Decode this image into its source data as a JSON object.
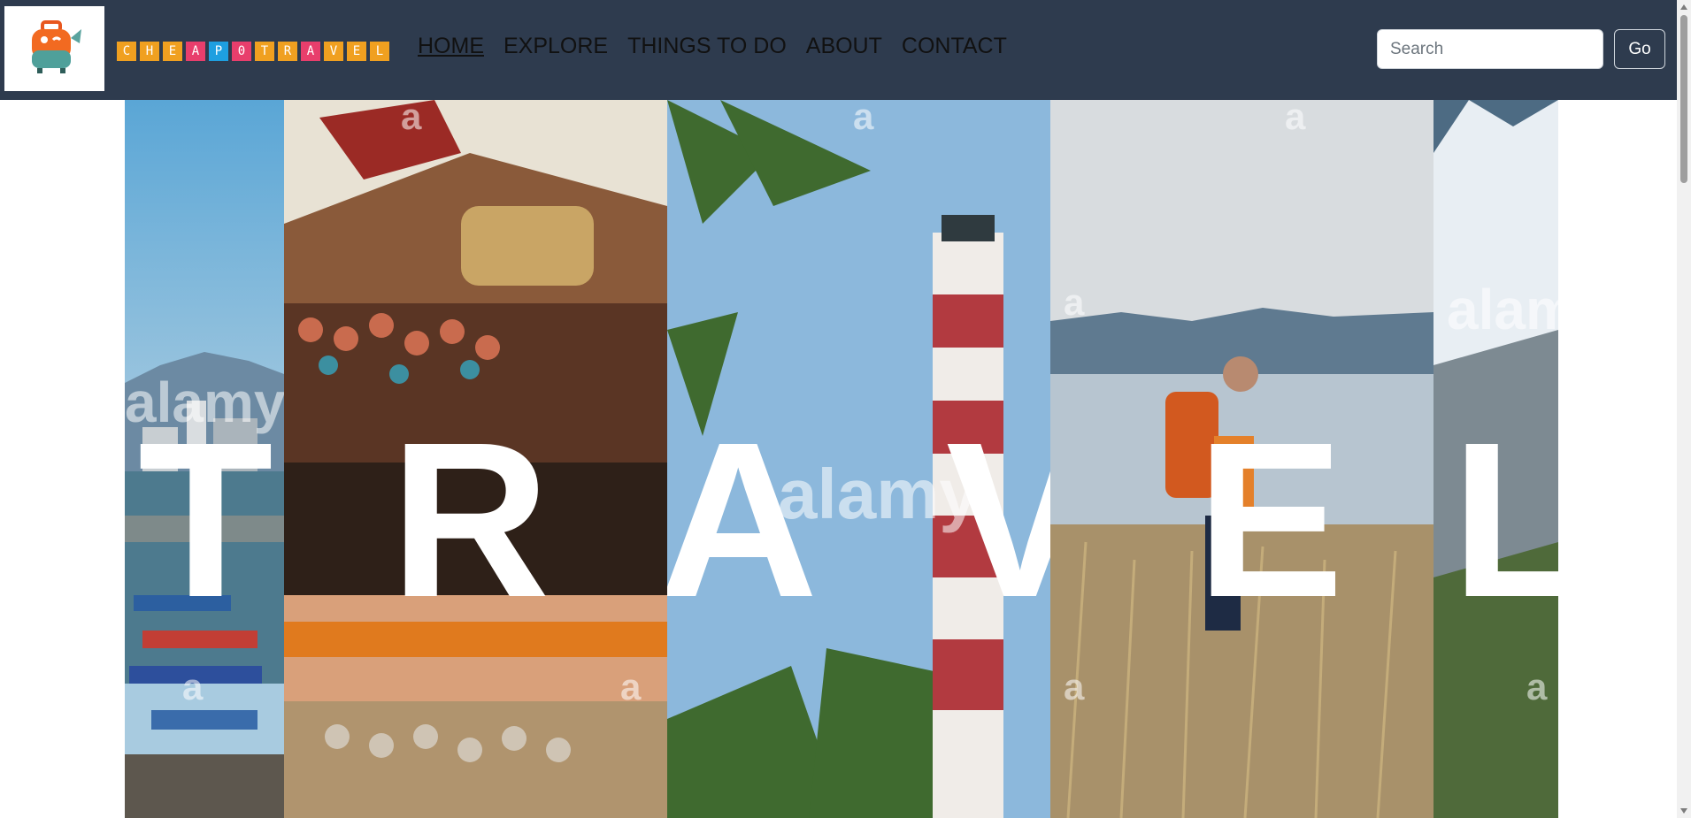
{
  "brand": {
    "letters": [
      {
        "char": "C",
        "color": "#f0a020"
      },
      {
        "char": "H",
        "color": "#f0a020"
      },
      {
        "char": "E",
        "color": "#f0a020"
      },
      {
        "char": "A",
        "color": "#e83e6c"
      },
      {
        "char": "P",
        "color": "#1e9fe0"
      },
      {
        "char": "0",
        "color": "#e83e6c"
      },
      {
        "char": "T",
        "color": "#f0a020"
      },
      {
        "char": "R",
        "color": "#f0a020"
      },
      {
        "char": "A",
        "color": "#e83e6c"
      },
      {
        "char": "V",
        "color": "#f0a020"
      },
      {
        "char": "E",
        "color": "#f0a020"
      },
      {
        "char": "L",
        "color": "#f0a020"
      }
    ]
  },
  "nav": {
    "items": [
      {
        "label": "HOME",
        "active": true
      },
      {
        "label": "EXPLORE",
        "active": false
      },
      {
        "label": "THINGS TO DO",
        "active": false
      },
      {
        "label": "ABOUT",
        "active": false
      },
      {
        "label": "CONTACT",
        "active": false
      }
    ]
  },
  "search": {
    "placeholder": "Search",
    "button_label": "Go"
  },
  "hero": {
    "letters": [
      "T",
      "R",
      "A",
      "V",
      "E",
      "L"
    ],
    "watermark": "alamy",
    "watermark_mark": "a"
  },
  "colors": {
    "navbar": "#2e3b4e",
    "brand_orange": "#f0a020",
    "brand_pink": "#e83e6c",
    "brand_blue": "#1e9fe0"
  },
  "icons": {
    "logo": "orange-suitcase-icon"
  }
}
